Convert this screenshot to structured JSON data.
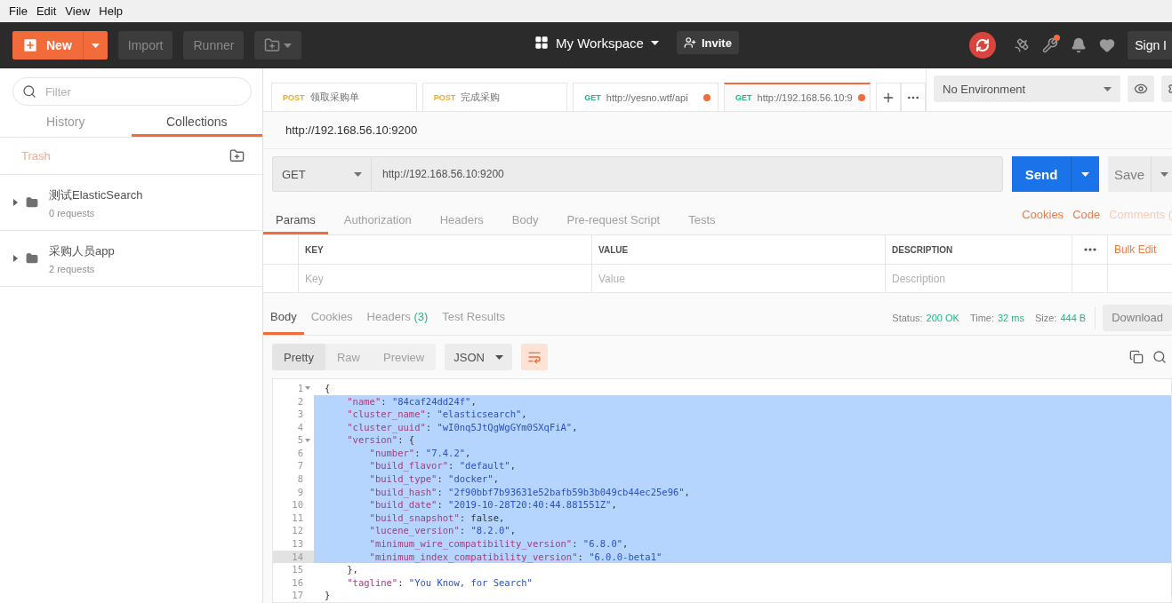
{
  "menu": [
    {
      "label": "File"
    },
    {
      "label": "Edit"
    },
    {
      "label": "View"
    },
    {
      "label": "Help"
    }
  ],
  "header": {
    "new": "New",
    "import": "Import",
    "runner": "Runner",
    "workspace": "My Workspace",
    "invite": "Invite",
    "sign_in": "Sign I",
    "wrench_badge": true
  },
  "sidebar": {
    "filter_placeholder": "Filter",
    "tabs": [
      {
        "label": "History",
        "selected": false
      },
      {
        "label": "Collections",
        "selected": true
      }
    ],
    "trash": "Trash",
    "collections": [
      {
        "name": "测试ElasticSearch",
        "count": "0 requests",
        "expanded": false
      },
      {
        "name": "采购人员app",
        "count": "2 requests",
        "expanded": false
      }
    ]
  },
  "request_tabs": [
    {
      "method": "POST",
      "color": "#f5a623",
      "title": "领取采购单",
      "unsaved": false,
      "selected": false
    },
    {
      "method": "POST",
      "color": "#f5a623",
      "title": "完成采购",
      "unsaved": false,
      "selected": false
    },
    {
      "method": "GET",
      "color": "#26b47f",
      "title": "http://yesno.wtf/api",
      "unsaved": true,
      "selected": false
    },
    {
      "method": "GET",
      "color": "#26b47f",
      "title": "http://192.168.56.10:9",
      "unsaved": true,
      "selected": true
    }
  ],
  "environment": "No Environment",
  "request": {
    "title": "http://192.168.56.10:9200",
    "method": "GET",
    "url": "http://192.168.56.10:9200",
    "send": "Send",
    "save": "Save"
  },
  "request_sections": [
    {
      "label": "Params",
      "selected": true
    },
    {
      "label": "Authorization",
      "selected": false
    },
    {
      "label": "Headers",
      "selected": false
    },
    {
      "label": "Body",
      "selected": false
    },
    {
      "label": "Pre-request Script",
      "selected": false
    },
    {
      "label": "Tests",
      "selected": false
    }
  ],
  "request_links": [
    {
      "label": "Cookies",
      "disabled": false
    },
    {
      "label": "Code",
      "disabled": false
    },
    {
      "label": "Comments (",
      "disabled": true
    }
  ],
  "params_table": {
    "columns": [
      "KEY",
      "VALUE",
      "DESCRIPTION"
    ],
    "bulk_edit": "Bulk Edit",
    "placeholders": [
      "Key",
      "Value",
      "Description"
    ]
  },
  "response_tabs": [
    {
      "label": "Body",
      "selected": true
    },
    {
      "label": "Cookies",
      "selected": false
    },
    {
      "label": "Headers",
      "count": "(3)",
      "selected": false
    },
    {
      "label": "Test Results",
      "selected": false
    }
  ],
  "response_stats": [
    {
      "label": "Status:",
      "value": "200 OK"
    },
    {
      "label": "Time:",
      "value": "32 ms"
    },
    {
      "label": "Size:",
      "value": "444 B"
    }
  ],
  "download": "Download",
  "view_modes": [
    {
      "label": "Pretty",
      "selected": true
    },
    {
      "label": "Raw",
      "selected": false
    },
    {
      "label": "Preview",
      "selected": false
    }
  ],
  "format": "JSON",
  "wrap_on": true,
  "code_lines": [
    {
      "number": "1",
      "foldable": true,
      "selected": false,
      "current": false,
      "segments": [
        {
          "kind": "punct",
          "text": "{"
        }
      ]
    },
    {
      "number": "2",
      "foldable": false,
      "selected": true,
      "current": false,
      "segments": [
        {
          "kind": "key",
          "text": "    \"name\""
        },
        {
          "kind": "punct",
          "text": ": "
        },
        {
          "kind": "string",
          "text": "\"84caf24dd24f\""
        },
        {
          "kind": "punct",
          "text": ","
        }
      ]
    },
    {
      "number": "3",
      "foldable": false,
      "selected": true,
      "current": false,
      "segments": [
        {
          "kind": "key",
          "text": "    \"cluster_name\""
        },
        {
          "kind": "punct",
          "text": ": "
        },
        {
          "kind": "string",
          "text": "\"elasticsearch\""
        },
        {
          "kind": "punct",
          "text": ","
        }
      ]
    },
    {
      "number": "4",
      "foldable": false,
      "selected": true,
      "current": false,
      "segments": [
        {
          "kind": "key",
          "text": "    \"cluster_uuid\""
        },
        {
          "kind": "punct",
          "text": ": "
        },
        {
          "kind": "string",
          "text": "\"wI0nq5JtQgWgGYm0SXqFiA\""
        },
        {
          "kind": "punct",
          "text": ","
        }
      ]
    },
    {
      "number": "5",
      "foldable": true,
      "selected": true,
      "current": false,
      "segments": [
        {
          "kind": "key",
          "text": "    \"version\""
        },
        {
          "kind": "punct",
          "text": ": {"
        }
      ]
    },
    {
      "number": "6",
      "foldable": false,
      "selected": true,
      "current": false,
      "segments": [
        {
          "kind": "key",
          "text": "        \"number\""
        },
        {
          "kind": "punct",
          "text": ": "
        },
        {
          "kind": "string",
          "text": "\"7.4.2\""
        },
        {
          "kind": "punct",
          "text": ","
        }
      ]
    },
    {
      "number": "7",
      "foldable": false,
      "selected": true,
      "current": false,
      "segments": [
        {
          "kind": "key",
          "text": "        \"build_flavor\""
        },
        {
          "kind": "punct",
          "text": ": "
        },
        {
          "kind": "string",
          "text": "\"default\""
        },
        {
          "kind": "punct",
          "text": ","
        }
      ]
    },
    {
      "number": "8",
      "foldable": false,
      "selected": true,
      "current": false,
      "segments": [
        {
          "kind": "key",
          "text": "        \"build_type\""
        },
        {
          "kind": "punct",
          "text": ": "
        },
        {
          "kind": "string",
          "text": "\"docker\""
        },
        {
          "kind": "punct",
          "text": ","
        }
      ]
    },
    {
      "number": "9",
      "foldable": false,
      "selected": true,
      "current": false,
      "segments": [
        {
          "kind": "key",
          "text": "        \"build_hash\""
        },
        {
          "kind": "punct",
          "text": ": "
        },
        {
          "kind": "string",
          "text": "\"2f90bbf7b93631e52bafb59b3b049cb44ec25e96\""
        },
        {
          "kind": "punct",
          "text": ","
        }
      ]
    },
    {
      "number": "10",
      "foldable": false,
      "selected": true,
      "current": false,
      "segments": [
        {
          "kind": "key",
          "text": "        \"build_date\""
        },
        {
          "kind": "punct",
          "text": ": "
        },
        {
          "kind": "string",
          "text": "\"2019-10-28T20:40:44.881551Z\""
        },
        {
          "kind": "punct",
          "text": ","
        }
      ]
    },
    {
      "number": "11",
      "foldable": false,
      "selected": true,
      "current": false,
      "segments": [
        {
          "kind": "key",
          "text": "        \"build_snapshot\""
        },
        {
          "kind": "punct",
          "text": ": false,"
        }
      ]
    },
    {
      "number": "12",
      "foldable": false,
      "selected": true,
      "current": false,
      "segments": [
        {
          "kind": "key",
          "text": "        \"lucene_version\""
        },
        {
          "kind": "punct",
          "text": ": "
        },
        {
          "kind": "string",
          "text": "\"8.2.0\""
        },
        {
          "kind": "punct",
          "text": ","
        }
      ]
    },
    {
      "number": "13",
      "foldable": false,
      "selected": true,
      "current": false,
      "segments": [
        {
          "kind": "key",
          "text": "        \"minimum_wire_compatibility_version\""
        },
        {
          "kind": "punct",
          "text": ": "
        },
        {
          "kind": "string",
          "text": "\"6.8.0\""
        },
        {
          "kind": "punct",
          "text": ","
        }
      ]
    },
    {
      "number": "14",
      "foldable": false,
      "selected": true,
      "current": true,
      "segments": [
        {
          "kind": "key",
          "text": "        \"minimum_index_compatibility_version\""
        },
        {
          "kind": "punct",
          "text": ": "
        },
        {
          "kind": "string",
          "text": "\"6.0.0-beta1\""
        }
      ]
    },
    {
      "number": "15",
      "foldable": false,
      "selected": false,
      "current": false,
      "segments": [
        {
          "kind": "punct",
          "text": "    },"
        }
      ]
    },
    {
      "number": "16",
      "foldable": false,
      "selected": false,
      "current": false,
      "segments": [
        {
          "kind": "key",
          "text": "    \"tagline\""
        },
        {
          "kind": "punct",
          "text": ": "
        },
        {
          "kind": "string",
          "text": "\"You Know, for Search\""
        }
      ]
    },
    {
      "number": "17",
      "foldable": false,
      "selected": false,
      "current": false,
      "segments": [
        {
          "kind": "punct",
          "text": "}"
        }
      ]
    }
  ]
}
